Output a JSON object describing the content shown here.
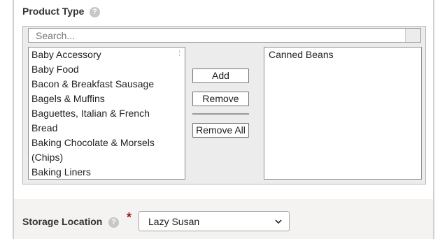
{
  "product_type": {
    "label": "Product Type",
    "help": "?",
    "search_placeholder": "Search...",
    "available": [
      "Baby Accessory",
      "Baby Food",
      "Bacon & Breakfast Sausage",
      "Bagels & Muffins",
      "Baguettes, Italian & French",
      "Bread",
      "Baking Chocolate & Morsels",
      "(Chips)",
      "Baking Liners"
    ],
    "selected": [
      "Canned Beans"
    ],
    "buttons": {
      "add": "Add",
      "remove": "Remove",
      "remove_all": "Remove All"
    }
  },
  "storage_location": {
    "label": "Storage Location",
    "help": "?",
    "required_mark": "*",
    "value": "Lazy Susan"
  },
  "colors": {
    "required": "#a11d1d",
    "help_bg": "#c7c7c7",
    "section_bg": "#f4f3f1"
  }
}
